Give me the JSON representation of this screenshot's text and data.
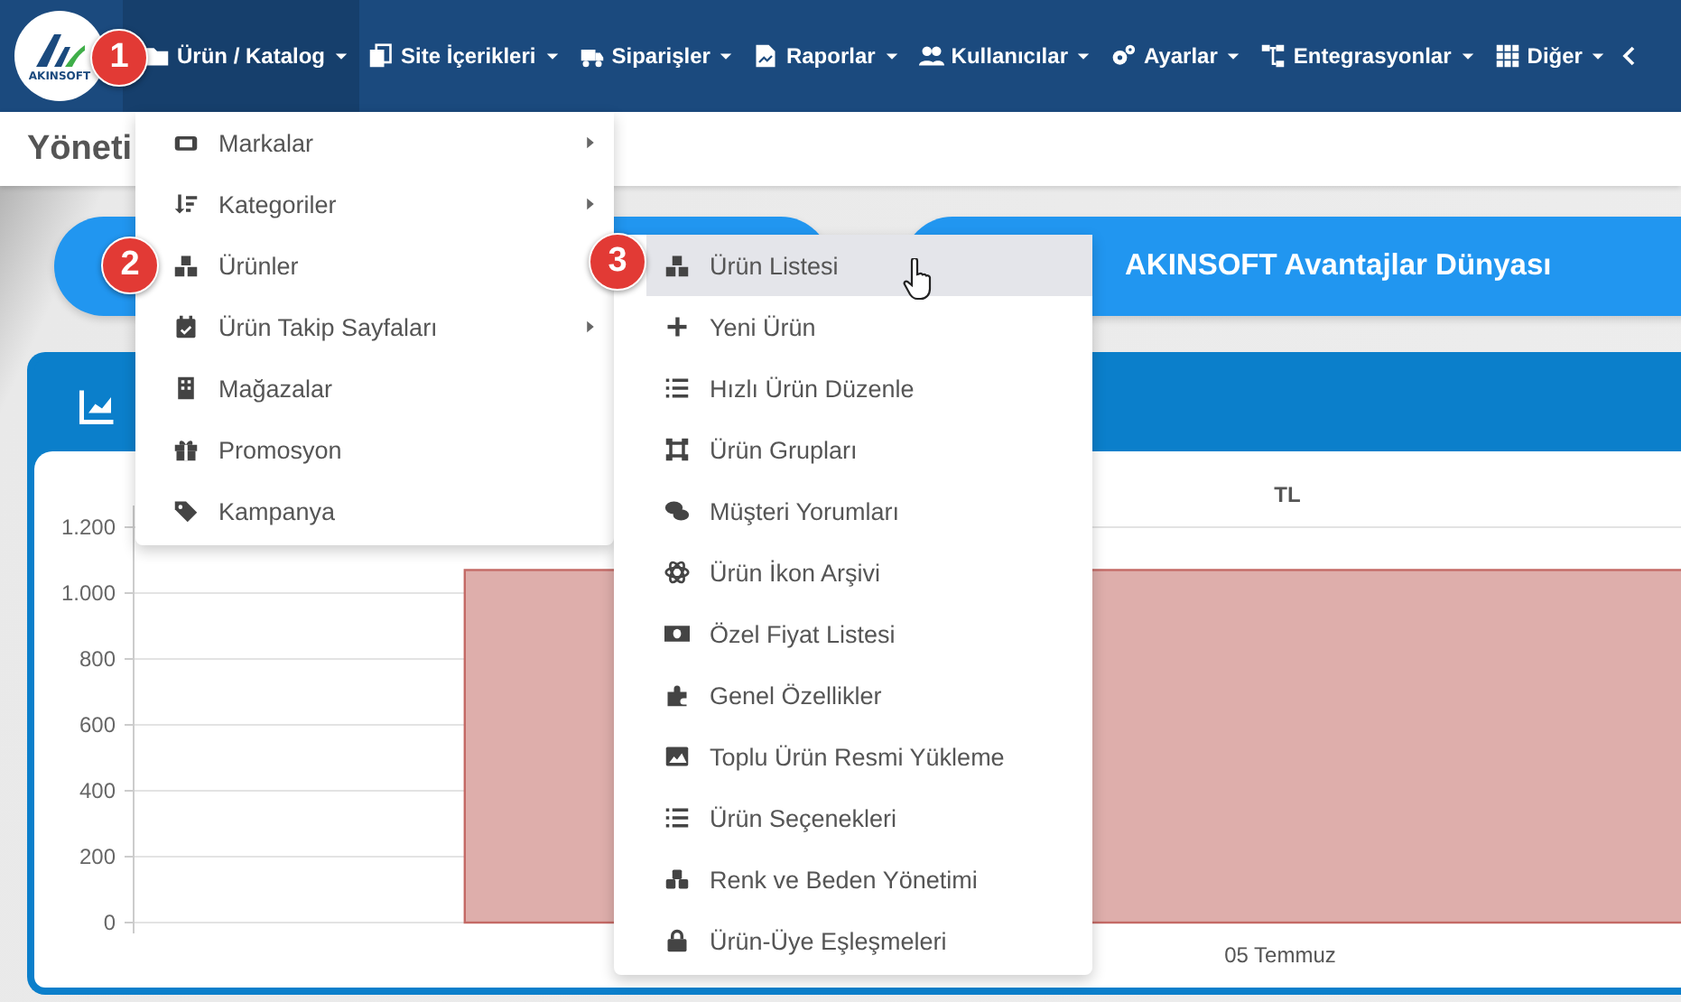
{
  "nav": {
    "logo_text": "AKINSOFT",
    "items": [
      {
        "label": "Ürün / Katalog",
        "selected": true
      },
      {
        "label": "Site İçerikleri",
        "selected": false
      },
      {
        "label": "Siparişler",
        "selected": false
      },
      {
        "label": "Raporlar",
        "selected": false
      },
      {
        "label": "Kullanıcılar",
        "selected": false
      },
      {
        "label": "Ayarlar",
        "selected": false
      },
      {
        "label": "Entegrasyonlar",
        "selected": false
      },
      {
        "label": "Diğer",
        "selected": false
      }
    ]
  },
  "page": {
    "title": "Yöneti"
  },
  "banner": {
    "label": "AKINSOFT Avantajlar Dünyası"
  },
  "menu": {
    "items": [
      {
        "label": "Markalar",
        "has_submenu": true
      },
      {
        "label": "Kategoriler",
        "has_submenu": true
      },
      {
        "label": "Ürünler",
        "has_submenu": false
      },
      {
        "label": "Ürün Takip Sayfaları",
        "has_submenu": true
      },
      {
        "label": "Mağazalar",
        "has_submenu": false
      },
      {
        "label": "Promosyon",
        "has_submenu": false
      },
      {
        "label": "Kampanya",
        "has_submenu": false
      }
    ]
  },
  "submenu": {
    "items": [
      {
        "label": "Ürün Listesi",
        "selected": true
      },
      {
        "label": "Yeni Ürün",
        "selected": false
      },
      {
        "label": "Hızlı Ürün Düzenle",
        "selected": false
      },
      {
        "label": "Ürün Grupları",
        "selected": false
      },
      {
        "label": "Müşteri Yorumları",
        "selected": false
      },
      {
        "label": "Ürün İkon Arşivi",
        "selected": false
      },
      {
        "label": "Özel Fiyat Listesi",
        "selected": false
      },
      {
        "label": "Genel Özellikler",
        "selected": false
      },
      {
        "label": "Toplu Ürün Resmi Yükleme",
        "selected": false
      },
      {
        "label": "Ürün Seçenekleri",
        "selected": false
      },
      {
        "label": "Renk ve Beden Yönetimi",
        "selected": false
      },
      {
        "label": "Ürün-Üye Eşleşmeleri",
        "selected": false
      }
    ]
  },
  "chart_card": {
    "chart_data": {
      "type": "bar",
      "grid": true,
      "categories": [
        "05 Temmuz"
      ],
      "series": [
        {
          "name": "TL",
          "color": "#deaeab",
          "values": [
            1070
          ]
        }
      ],
      "ylim": [
        0,
        1200
      ],
      "yticks": [
        {
          "value": 0,
          "label": "0"
        },
        {
          "value": 200,
          "label": "200"
        },
        {
          "value": 400,
          "label": "400"
        },
        {
          "value": 600,
          "label": "600"
        },
        {
          "value": 800,
          "label": "800"
        },
        {
          "value": 1000,
          "label": "1.000"
        },
        {
          "value": 1200,
          "label": "1.200"
        }
      ]
    }
  },
  "step_badges": [
    "1",
    "2",
    "3"
  ]
}
